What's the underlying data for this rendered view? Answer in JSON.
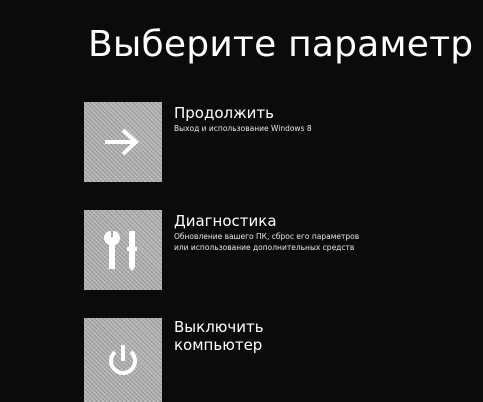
{
  "screen": {
    "title": "Выберите параметр"
  },
  "options": [
    {
      "title": "Продолжить",
      "description": "Выход и использование Windows 8",
      "icon": "arrow-right-icon"
    },
    {
      "title": "Диагностика",
      "description": "Обновление вашего ПК, сброс его параметров или использование дополнительных средств",
      "icon": "tools-icon"
    },
    {
      "title": "Выключить компьютер",
      "description": "",
      "icon": "power-icon"
    }
  ],
  "colors": {
    "background": "#0b0b0b",
    "tile": "#b5b5b5",
    "text": "#ffffff"
  }
}
